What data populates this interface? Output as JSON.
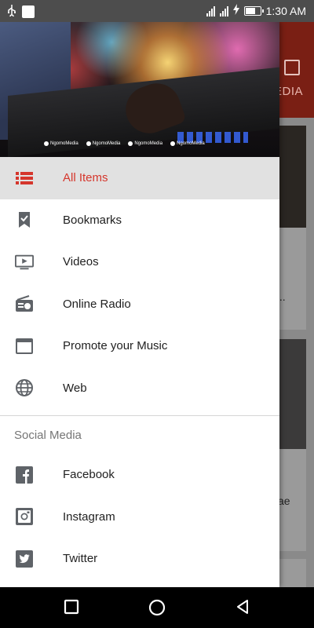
{
  "status_bar": {
    "time": "1:30 AM"
  },
  "background_app": {
    "tab_partial": "EDIA",
    "card_text_1": "...",
    "card_text_2": "ae"
  },
  "drawer": {
    "header": {
      "social_handles": [
        "NgomoMedia",
        "NgomoMedia",
        "NgomoMedia",
        "NgomoMedia"
      ]
    },
    "items": [
      {
        "label": "All Items",
        "icon": "list-icon",
        "active": true
      },
      {
        "label": "Bookmarks",
        "icon": "bookmark-icon",
        "active": false
      },
      {
        "label": "Videos",
        "icon": "tv-play-icon",
        "active": false
      },
      {
        "label": "Online Radio",
        "icon": "radio-icon",
        "active": false
      },
      {
        "label": "Promote your Music",
        "icon": "browser-window-icon",
        "active": false
      },
      {
        "label": "Web",
        "icon": "globe-icon",
        "active": false
      }
    ],
    "section_title": "Social Media",
    "social_items": [
      {
        "label": "Facebook",
        "icon": "facebook-icon"
      },
      {
        "label": "Instagram",
        "icon": "instagram-icon"
      },
      {
        "label": "Twitter",
        "icon": "twitter-icon"
      }
    ]
  },
  "colors": {
    "accent": "#d5362c",
    "active_bg": "#e1e1e1",
    "icon_gray": "#5f6368"
  }
}
